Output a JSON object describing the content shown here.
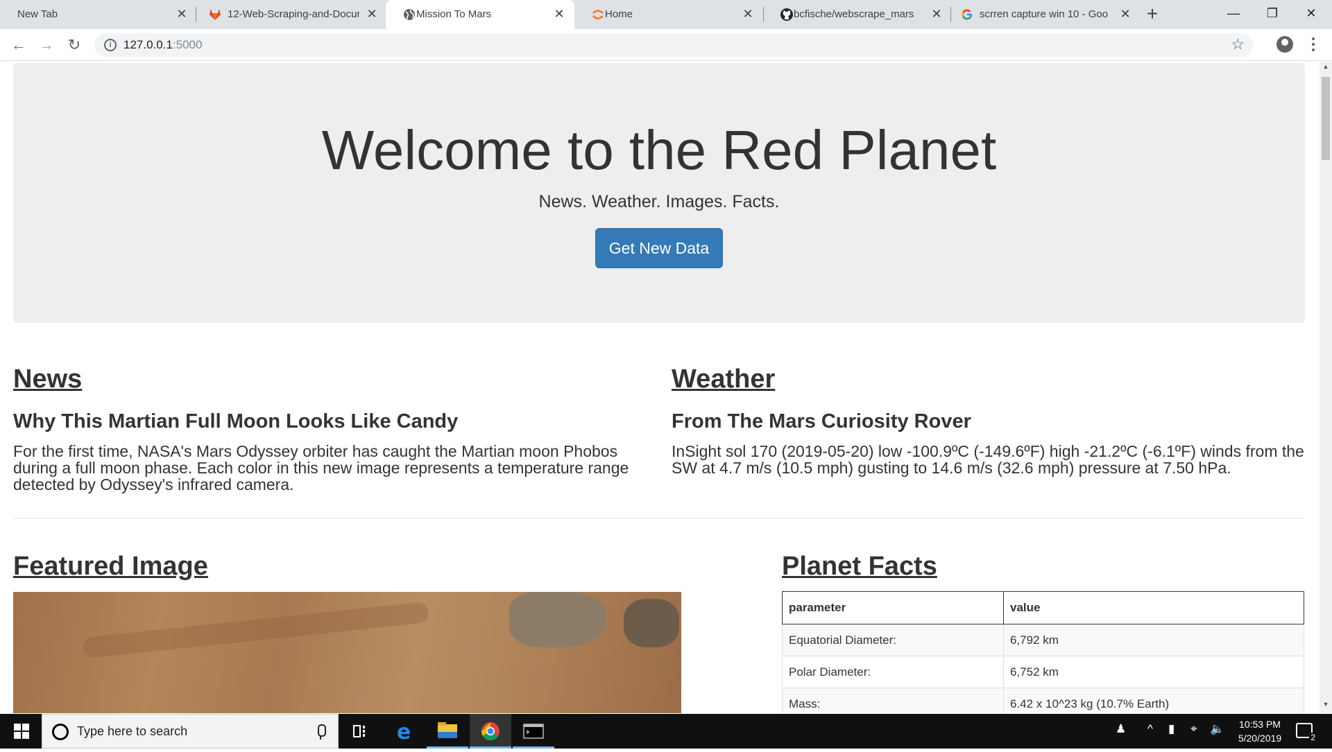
{
  "browser": {
    "tabs": [
      {
        "title": "New Tab",
        "icon": "none",
        "active": false
      },
      {
        "title": "12-Web-Scraping-and-Docur",
        "icon": "gitlab-icon",
        "active": false
      },
      {
        "title": "Mission To Mars",
        "icon": "globe-icon",
        "active": true
      },
      {
        "title": "Home",
        "icon": "jupyter-icon",
        "active": false
      },
      {
        "title": "bcfische/webscrape_mars",
        "icon": "github-icon",
        "active": false
      },
      {
        "title": "scrren capture win 10 - Goog",
        "icon": "google-icon",
        "active": false
      }
    ],
    "url_host": "127.0.0.1",
    "url_port": ":5000"
  },
  "jumbotron": {
    "title": "Welcome to the Red Planet",
    "subtitle": "News. Weather. Images. Facts.",
    "button_label": "Get New Data"
  },
  "news": {
    "heading": "News",
    "title": "Why This Martian Full Moon Looks Like Candy",
    "lines": [
      "For the first time, NASA's Mars Odyssey orbiter has caught the Martian moon Phobos",
      "during a full moon phase. Each color in this new image represents a temperature range",
      "detected by Odyssey's infrared camera."
    ]
  },
  "weather": {
    "heading": "Weather",
    "title": "From The Mars Curiosity Rover",
    "lines": [
      "InSight sol 170 (2019-05-20) low -100.9ºC (-149.6ºF) high -21.2ºC (-6.1ºF) winds from the",
      "SW at 4.7 m/s (10.5 mph) gusting to 14.6 m/s (32.6 mph) pressure at 7.50 hPa."
    ]
  },
  "featured": {
    "heading": "Featured Image"
  },
  "facts": {
    "heading": "Planet Facts",
    "columns": [
      "parameter",
      "value"
    ],
    "rows": [
      [
        "Equatorial Diameter:",
        "6,792 km"
      ],
      [
        "Polar Diameter:",
        "6,752 km"
      ],
      [
        "Mass:",
        "6.42 x 10^23 kg (10.7% Earth)"
      ]
    ]
  },
  "taskbar": {
    "search_placeholder": "Type here to search",
    "time": "10:53 PM",
    "date": "5/20/2019",
    "notification_count": "2"
  },
  "colors": {
    "primary_button": "#337ab7",
    "jumbotron_bg": "#eeeeee",
    "taskbar_bg": "#101010"
  }
}
